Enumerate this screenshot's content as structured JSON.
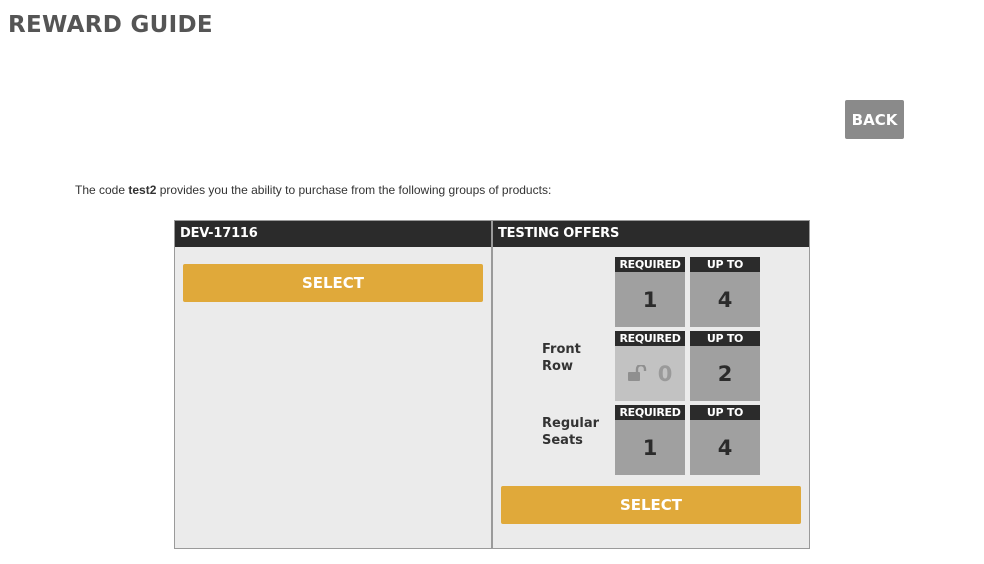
{
  "header": {
    "title": "REWARD GUIDE",
    "back_label": "BACK"
  },
  "intro": {
    "prefix": "The code ",
    "code": "test2",
    "suffix": " provides you the ability to purchase from the following groups of products:"
  },
  "groups": [
    {
      "title": "DEV-17116",
      "select_label": "SELECT",
      "rows": []
    },
    {
      "title": "TESTING OFFERS",
      "select_label": "SELECT",
      "rows": [
        {
          "label": "",
          "required_header": "REQUIRED",
          "required": "1",
          "upto_header": "UP TO",
          "upto": "4",
          "locked": false
        },
        {
          "label_line1": "Front",
          "label_line2": "Row",
          "required_header": "REQUIRED",
          "required": "0",
          "upto_header": "UP TO",
          "upto": "2",
          "locked": true,
          "lock_icon": "unlock-icon"
        },
        {
          "label_line1": "Regular",
          "label_line2": "Seats",
          "required_header": "REQUIRED",
          "required": "1",
          "upto_header": "UP TO",
          "upto": "4",
          "locked": false
        }
      ]
    }
  ],
  "colors": {
    "accent": "#e0a93a",
    "header_dark": "#2b2b2b",
    "back_button": "#8a8a8a",
    "cell_bg": "#a0a0a0",
    "panel_bg": "#ebebeb"
  }
}
